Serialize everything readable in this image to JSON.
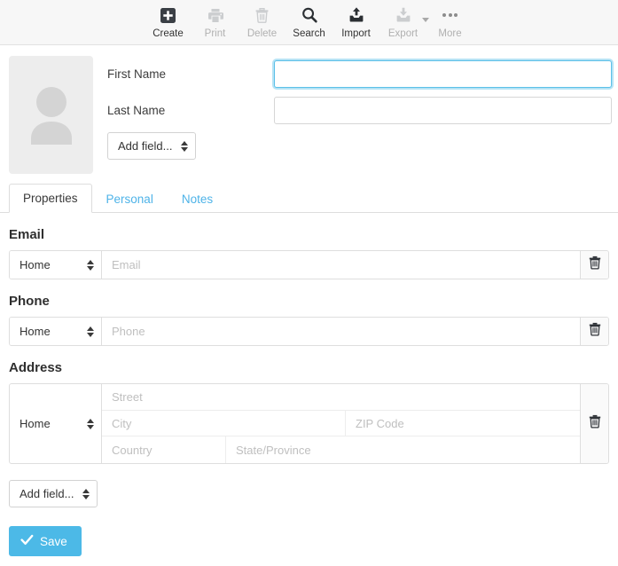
{
  "toolbar": {
    "items": [
      {
        "label": "Create",
        "icon": "create-icon",
        "disabled": false,
        "caret": false
      },
      {
        "label": "Print",
        "icon": "print-icon",
        "disabled": true,
        "caret": false
      },
      {
        "label": "Delete",
        "icon": "delete-icon",
        "disabled": true,
        "caret": false
      },
      {
        "label": "Search",
        "icon": "search-icon",
        "disabled": false,
        "caret": false
      },
      {
        "label": "Import",
        "icon": "import-icon",
        "disabled": false,
        "caret": false
      },
      {
        "label": "Export",
        "icon": "export-icon",
        "disabled": true,
        "caret": true
      },
      {
        "label": "More",
        "icon": "more-icon",
        "disabled": true,
        "caret": false
      }
    ]
  },
  "contact": {
    "avatar_icon": "person-placeholder-icon",
    "first_name": {
      "label": "First Name",
      "value": "",
      "placeholder": "",
      "focused": true
    },
    "last_name": {
      "label": "Last Name",
      "value": "",
      "placeholder": "",
      "focused": false
    },
    "add_field_top": "Add field..."
  },
  "tabs": [
    {
      "label": "Properties",
      "active": true
    },
    {
      "label": "Personal",
      "active": false
    },
    {
      "label": "Notes",
      "active": false
    }
  ],
  "sections": {
    "email": {
      "title": "Email",
      "type_value": "Home",
      "placeholder": "Email",
      "value": "",
      "delete_icon": "trash-icon"
    },
    "phone": {
      "title": "Phone",
      "type_value": "Home",
      "placeholder": "Phone",
      "value": "",
      "delete_icon": "trash-icon"
    },
    "address": {
      "title": "Address",
      "type_value": "Home",
      "street_placeholder": "Street",
      "city_placeholder": "City",
      "zip_placeholder": "ZIP Code",
      "country_placeholder": "Country",
      "state_placeholder": "State/Province",
      "street_value": "",
      "city_value": "",
      "zip_value": "",
      "country_value": "",
      "state_value": "",
      "delete_icon": "trash-icon"
    }
  },
  "add_field_bottom": "Add field...",
  "save": {
    "label": "Save",
    "icon": "check-icon"
  },
  "colors": {
    "accent": "#4cb9e7",
    "link": "#4eb3e8",
    "toolbar_bg": "#f7f7f7",
    "border": "#dedede",
    "placeholder": "#bfbfbf",
    "avatar_bg": "#ededed"
  }
}
